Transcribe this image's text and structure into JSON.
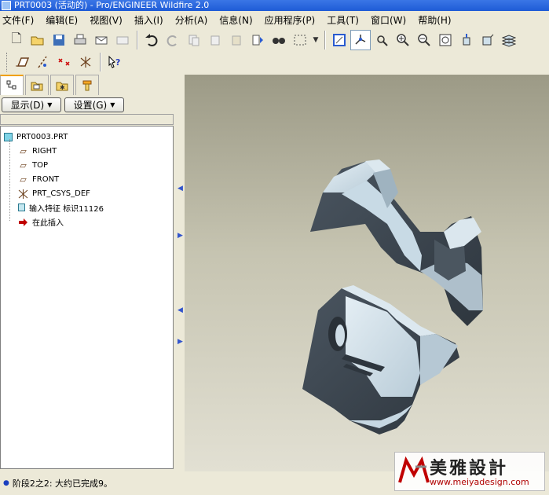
{
  "window": {
    "title": "PRT0003 (活动的) - Pro/ENGINEER Wildfire 2.0"
  },
  "menubar": {
    "items": [
      "文件(F)",
      "编辑(E)",
      "视图(V)",
      "插入(I)",
      "分析(A)",
      "信息(N)",
      "应用程序(P)",
      "工具(T)",
      "窗口(W)",
      "帮助(H)"
    ]
  },
  "toolbar_icons": {
    "row1": [
      "new-icon",
      "open-icon",
      "save-icon",
      "print-icon",
      "send-mail-icon",
      "send-mail-gray-icon",
      "undo-icon",
      "redo-icon",
      "cut-icon",
      "copy-icon",
      "paste-icon",
      "paste-special-icon",
      "regenerate-icon",
      "find-icon",
      "select-box-icon",
      "dropdown-arrow-icon",
      "datum-plane-display-icon",
      "datum-axis-display-icon",
      "point-display-icon",
      "zoom-in-icon",
      "zoom-out-icon",
      "refit-icon",
      "reorient-icon",
      "saved-views-icon",
      "layers-icon"
    ],
    "row2": [
      "plane-display-icon",
      "axis-display-icon",
      "point-display-icon",
      "csys-display-icon",
      "whats-this-icon"
    ]
  },
  "model_tree_tabs": [
    "model-tree-tab",
    "folder-browser-tab",
    "favorites-tab",
    "connections-tab"
  ],
  "panel_buttons": {
    "show": "显示(D)",
    "settings": "设置(G)"
  },
  "model_tree": {
    "root": "PRT0003.PRT",
    "items": [
      {
        "label": "RIGHT",
        "icon": "datum-plane-icon"
      },
      {
        "label": "TOP",
        "icon": "datum-plane-icon"
      },
      {
        "label": "FRONT",
        "icon": "datum-plane-icon"
      },
      {
        "label": "PRT_CSYS_DEF",
        "icon": "csys-icon"
      },
      {
        "label": "输入特征 标识11126",
        "icon": "import-feature-icon"
      },
      {
        "label": "在此插入",
        "icon": "insert-here-icon"
      }
    ]
  },
  "status": {
    "message": "阶段2之2: 大约已完成9。"
  },
  "watermark": {
    "name": "美雅設計",
    "url": "www.meiyadesign.com"
  },
  "colors": {
    "window_bg": "#ece9d8",
    "part_surface": "#cfe0ea",
    "part_shadow": "#3c4650",
    "watermark_red": "#b00000"
  }
}
